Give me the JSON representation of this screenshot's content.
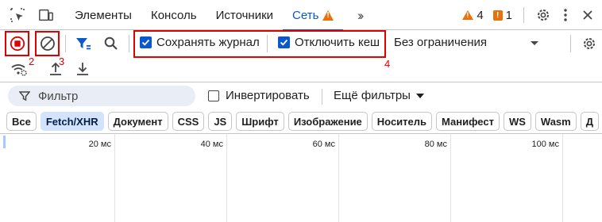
{
  "tabbar": {
    "tabs": [
      {
        "label": "Элементы"
      },
      {
        "label": "Консоль"
      },
      {
        "label": "Источники"
      },
      {
        "label": "Сеть"
      }
    ],
    "warnings_count": "4",
    "issues_count": "1"
  },
  "toolbar": {
    "annotation_record": "2",
    "annotation_clear": "3",
    "annotation_checkboxes": "4",
    "preserve_log_label": "Сохранять журнал",
    "preserve_log_checked": true,
    "disable_cache_label": "Отключить кеш",
    "disable_cache_checked": true,
    "throttling_value": "Без ограничения"
  },
  "filter": {
    "placeholder": "Фильтр",
    "invert_label": "Инвертировать",
    "invert_checked": false,
    "more_filters_label": "Ещё фильтры"
  },
  "type_filters": [
    {
      "label": "Все",
      "active": false
    },
    {
      "label": "Fetch/XHR",
      "active": true
    },
    {
      "label": "Документ",
      "active": false
    },
    {
      "label": "CSS",
      "active": false
    },
    {
      "label": "JS",
      "active": false
    },
    {
      "label": "Шрифт",
      "active": false
    },
    {
      "label": "Изображение",
      "active": false
    },
    {
      "label": "Носитель",
      "active": false
    },
    {
      "label": "Манифест",
      "active": false
    },
    {
      "label": "WS",
      "active": false
    },
    {
      "label": "Wasm",
      "active": false
    },
    {
      "label": "Д",
      "active": false
    }
  ],
  "timeline": {
    "ticks": [
      "20 мс",
      "40 мс",
      "60 мс",
      "80 мс",
      "100 мс"
    ]
  },
  "colors": {
    "accent": "#0b57d0",
    "warning": "#e8710a",
    "annotation": "#e00000"
  }
}
